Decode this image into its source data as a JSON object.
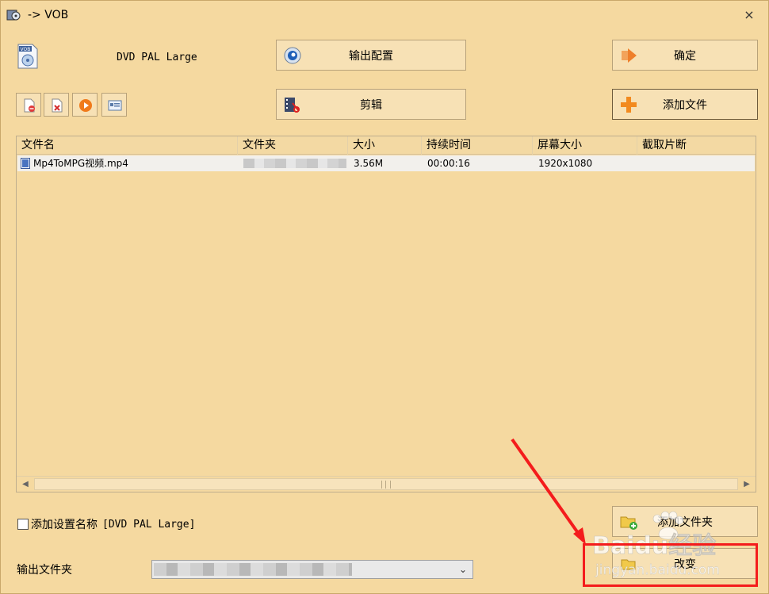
{
  "window": {
    "title": "-> VOB",
    "close_glyph": "×"
  },
  "profile": {
    "name": "DVD PAL Large"
  },
  "buttons": {
    "output_config": "输出配置",
    "ok": "确定",
    "edit": "剪辑",
    "add_file": "添加文件",
    "add_folder": "添加文件夹",
    "change": "改变"
  },
  "toolbar": {
    "items": [
      {
        "icon": "remove-file-icon"
      },
      {
        "icon": "clear-list-icon"
      },
      {
        "icon": "play-icon"
      },
      {
        "icon": "file-info-icon"
      }
    ]
  },
  "file_list": {
    "columns": [
      "文件名",
      "文件夹",
      "大小",
      "持续时间",
      "屏幕大小",
      "截取片断"
    ],
    "rows": [
      {
        "name": "Mp4ToMPG视频.mp4",
        "size": "3.56M",
        "duration": "00:00:16",
        "resolution": "1920x1080",
        "clip": ""
      }
    ]
  },
  "options": {
    "add_setting_name_label": "添加设置名称",
    "add_setting_name_value": "[DVD PAL Large]",
    "add_setting_name_checked": false
  },
  "output": {
    "label": "输出文件夹"
  },
  "watermark": {
    "text": "Baidu经验",
    "url": "jingyan.baidu.com"
  },
  "colors": {
    "background": "#f5d9a0",
    "annotation": "#f41c1c"
  }
}
